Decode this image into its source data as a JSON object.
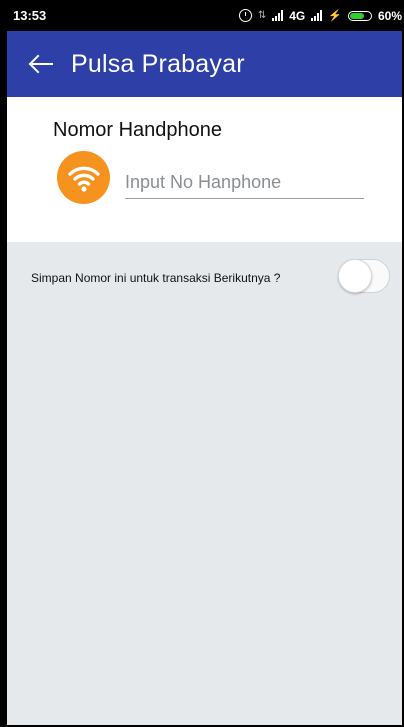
{
  "status_bar": {
    "time": "13:53",
    "network_1": "4G",
    "battery_text": "60%"
  },
  "app_bar": {
    "title": "Pulsa Prabayar",
    "back_icon": "arrow-left-icon",
    "background_color": "#2e3fa8"
  },
  "phone_form": {
    "label": "Nomor Handphone",
    "icon": "wifi-icon",
    "icon_color": "#f6931e",
    "input_value": "",
    "input_placeholder": "Input No Hanphone"
  },
  "save_option": {
    "label": "Simpan Nomor ini untuk transaksi Berikutnya ?",
    "enabled": false
  }
}
